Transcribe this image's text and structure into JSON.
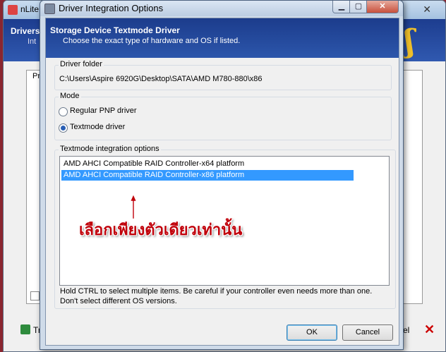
{
  "background_window": {
    "title": "nLite",
    "header_title": "Drivers",
    "header_sub": "Int",
    "panel_label": "Pr",
    "left_button_label": "Tr",
    "right_button_label": "cel"
  },
  "dialog": {
    "title": "Driver Integration Options",
    "header_title": "Storage Device Textmode Driver",
    "header_subtitle": "Choose the exact type of hardware and OS if listed.",
    "driver_folder": {
      "label": "Driver folder",
      "path": "C:\\Users\\Aspire 6920G\\Desktop\\SATA\\AMD M780-880\\x86"
    },
    "mode": {
      "label": "Mode",
      "options": [
        {
          "label": "Regular PNP driver",
          "selected": false
        },
        {
          "label": "Textmode driver",
          "selected": true
        }
      ]
    },
    "textmode_options": {
      "label": "Textmode integration options",
      "items": [
        {
          "label": "AMD AHCI Compatible RAID Controller-x64 platform",
          "selected": false
        },
        {
          "label": "AMD AHCI Compatible RAID Controller-x86 platform",
          "selected": true
        }
      ]
    },
    "annotation": "เลือกเพียงตัวเดียวเท่านั้น",
    "hint": "Hold CTRL to select multiple items. Be careful if your controller even needs more than one. Don't select different OS versions.",
    "ok_label": "OK",
    "cancel_label": "Cancel"
  },
  "colors": {
    "header_blue": "#1c3c8c",
    "selection": "#3399ff",
    "annotation_red": "#c0000a"
  }
}
